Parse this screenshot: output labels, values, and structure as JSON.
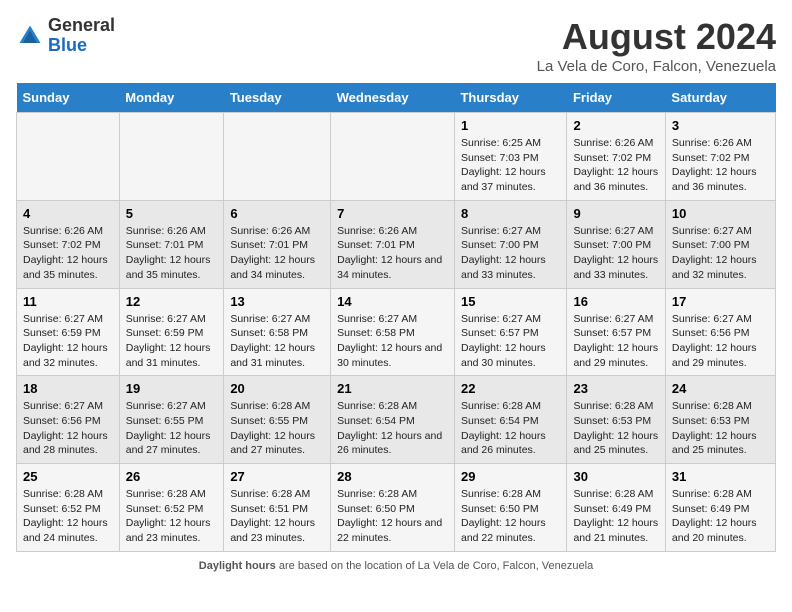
{
  "logo": {
    "general": "General",
    "blue": "Blue"
  },
  "header": {
    "title": "August 2024",
    "subtitle": "La Vela de Coro, Falcon, Venezuela"
  },
  "days_of_week": [
    "Sunday",
    "Monday",
    "Tuesday",
    "Wednesday",
    "Thursday",
    "Friday",
    "Saturday"
  ],
  "weeks": [
    [
      {
        "day": "",
        "info": ""
      },
      {
        "day": "",
        "info": ""
      },
      {
        "day": "",
        "info": ""
      },
      {
        "day": "",
        "info": ""
      },
      {
        "day": "1",
        "info": "Sunrise: 6:25 AM\nSunset: 7:03 PM\nDaylight: 12 hours and 37 minutes."
      },
      {
        "day": "2",
        "info": "Sunrise: 6:26 AM\nSunset: 7:02 PM\nDaylight: 12 hours and 36 minutes."
      },
      {
        "day": "3",
        "info": "Sunrise: 6:26 AM\nSunset: 7:02 PM\nDaylight: 12 hours and 36 minutes."
      }
    ],
    [
      {
        "day": "4",
        "info": "Sunrise: 6:26 AM\nSunset: 7:02 PM\nDaylight: 12 hours and 35 minutes."
      },
      {
        "day": "5",
        "info": "Sunrise: 6:26 AM\nSunset: 7:01 PM\nDaylight: 12 hours and 35 minutes."
      },
      {
        "day": "6",
        "info": "Sunrise: 6:26 AM\nSunset: 7:01 PM\nDaylight: 12 hours and 34 minutes."
      },
      {
        "day": "7",
        "info": "Sunrise: 6:26 AM\nSunset: 7:01 PM\nDaylight: 12 hours and 34 minutes."
      },
      {
        "day": "8",
        "info": "Sunrise: 6:27 AM\nSunset: 7:00 PM\nDaylight: 12 hours and 33 minutes."
      },
      {
        "day": "9",
        "info": "Sunrise: 6:27 AM\nSunset: 7:00 PM\nDaylight: 12 hours and 33 minutes."
      },
      {
        "day": "10",
        "info": "Sunrise: 6:27 AM\nSunset: 7:00 PM\nDaylight: 12 hours and 32 minutes."
      }
    ],
    [
      {
        "day": "11",
        "info": "Sunrise: 6:27 AM\nSunset: 6:59 PM\nDaylight: 12 hours and 32 minutes."
      },
      {
        "day": "12",
        "info": "Sunrise: 6:27 AM\nSunset: 6:59 PM\nDaylight: 12 hours and 31 minutes."
      },
      {
        "day": "13",
        "info": "Sunrise: 6:27 AM\nSunset: 6:58 PM\nDaylight: 12 hours and 31 minutes."
      },
      {
        "day": "14",
        "info": "Sunrise: 6:27 AM\nSunset: 6:58 PM\nDaylight: 12 hours and 30 minutes."
      },
      {
        "day": "15",
        "info": "Sunrise: 6:27 AM\nSunset: 6:57 PM\nDaylight: 12 hours and 30 minutes."
      },
      {
        "day": "16",
        "info": "Sunrise: 6:27 AM\nSunset: 6:57 PM\nDaylight: 12 hours and 29 minutes."
      },
      {
        "day": "17",
        "info": "Sunrise: 6:27 AM\nSunset: 6:56 PM\nDaylight: 12 hours and 29 minutes."
      }
    ],
    [
      {
        "day": "18",
        "info": "Sunrise: 6:27 AM\nSunset: 6:56 PM\nDaylight: 12 hours and 28 minutes."
      },
      {
        "day": "19",
        "info": "Sunrise: 6:27 AM\nSunset: 6:55 PM\nDaylight: 12 hours and 27 minutes."
      },
      {
        "day": "20",
        "info": "Sunrise: 6:28 AM\nSunset: 6:55 PM\nDaylight: 12 hours and 27 minutes."
      },
      {
        "day": "21",
        "info": "Sunrise: 6:28 AM\nSunset: 6:54 PM\nDaylight: 12 hours and 26 minutes."
      },
      {
        "day": "22",
        "info": "Sunrise: 6:28 AM\nSunset: 6:54 PM\nDaylight: 12 hours and 26 minutes."
      },
      {
        "day": "23",
        "info": "Sunrise: 6:28 AM\nSunset: 6:53 PM\nDaylight: 12 hours and 25 minutes."
      },
      {
        "day": "24",
        "info": "Sunrise: 6:28 AM\nSunset: 6:53 PM\nDaylight: 12 hours and 25 minutes."
      }
    ],
    [
      {
        "day": "25",
        "info": "Sunrise: 6:28 AM\nSunset: 6:52 PM\nDaylight: 12 hours and 24 minutes."
      },
      {
        "day": "26",
        "info": "Sunrise: 6:28 AM\nSunset: 6:52 PM\nDaylight: 12 hours and 23 minutes."
      },
      {
        "day": "27",
        "info": "Sunrise: 6:28 AM\nSunset: 6:51 PM\nDaylight: 12 hours and 23 minutes."
      },
      {
        "day": "28",
        "info": "Sunrise: 6:28 AM\nSunset: 6:50 PM\nDaylight: 12 hours and 22 minutes."
      },
      {
        "day": "29",
        "info": "Sunrise: 6:28 AM\nSunset: 6:50 PM\nDaylight: 12 hours and 22 minutes."
      },
      {
        "day": "30",
        "info": "Sunrise: 6:28 AM\nSunset: 6:49 PM\nDaylight: 12 hours and 21 minutes."
      },
      {
        "day": "31",
        "info": "Sunrise: 6:28 AM\nSunset: 6:49 PM\nDaylight: 12 hours and 20 minutes."
      }
    ]
  ],
  "footer": {
    "label": "Daylight hours",
    "text": "are based on the location of La Vela de Coro, Falcon, Venezuela"
  }
}
